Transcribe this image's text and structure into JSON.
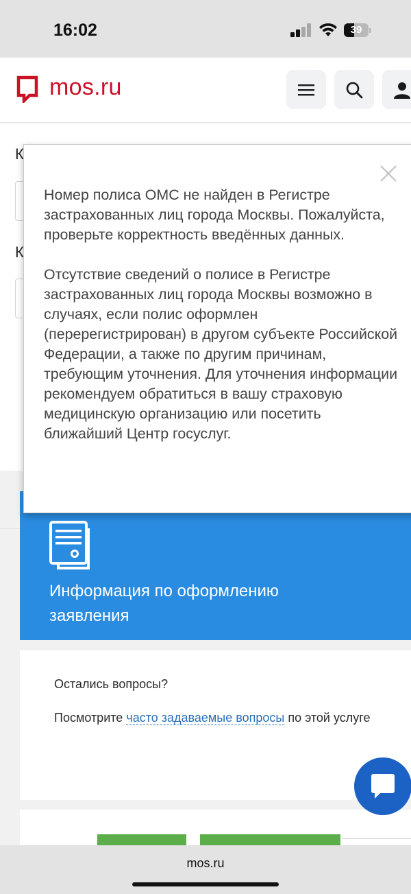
{
  "status_bar": {
    "time": "16:02",
    "battery_level": "39",
    "icons": [
      "signal-icon",
      "wifi-icon",
      "battery-icon"
    ]
  },
  "header": {
    "logo_text": "mos.ru",
    "brand_color": "#cc1126",
    "icons": [
      "menu-icon",
      "search-icon",
      "profile-icon"
    ]
  },
  "form_behind": {
    "label_1": "К",
    "label_2": "К"
  },
  "modal": {
    "paragraph_1": "Номер полиса ОМС не найден в Регистре застрахованных лиц города Москвы. Пожалуйста, проверьте корректность введённых данных.",
    "paragraph_2": "Отсутствие сведений о полисе в Регистре застрахованных лиц города Москвы возможно в случаях, если полис оформлен (перерегистрирован) в другом субъекте Российской Федерации, а также по другим причинам, требующим уточнения. Для уточнения информации рекомендуем обратиться в вашу страховую медицинскую организацию или посетить ближайший Центр госуслуг."
  },
  "info_card": {
    "title": "Информация по оформлению заявления",
    "color": "#2a8ce0"
  },
  "faq": {
    "title": "Остались вопросы?",
    "text_before": "Посмотрите ",
    "link_text": "часто задаваемые вопросы",
    "text_after": " по этой услуге"
  },
  "browser": {
    "url": "mos.ru"
  }
}
